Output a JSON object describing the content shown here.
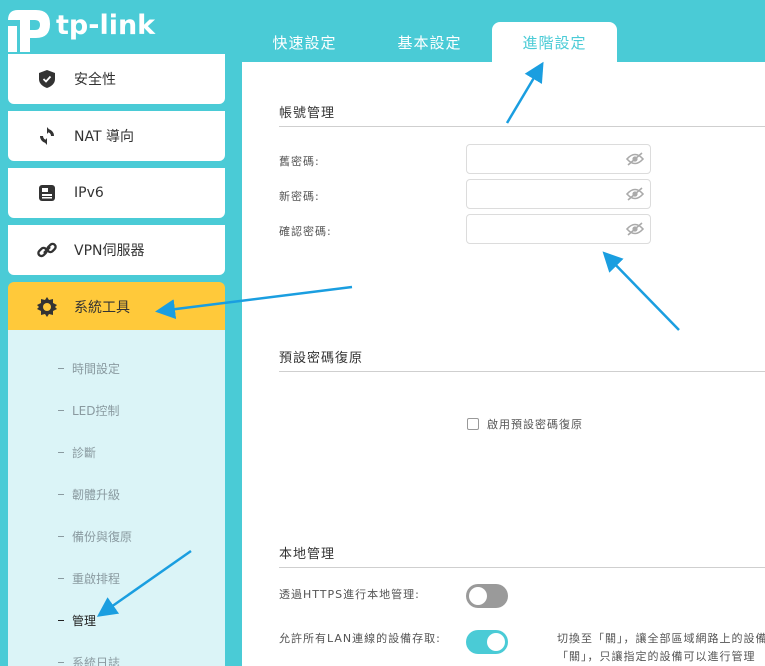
{
  "brand": {
    "name": "tp-link",
    "color": "#4acbd6",
    "active_color": "#ffc93a",
    "arrow_color": "#1a9ee0"
  },
  "tabs": [
    {
      "label": "快速設定",
      "active": false
    },
    {
      "label": "基本設定",
      "active": false
    },
    {
      "label": "進階設定",
      "active": true
    }
  ],
  "sidebar": {
    "items": [
      {
        "label": "安全性",
        "icon": "shield-icon"
      },
      {
        "label": "NAT 導向",
        "icon": "refresh-icon"
      },
      {
        "label": "IPv6",
        "icon": "document-icon"
      },
      {
        "label": "VPN伺服器",
        "icon": "link-icon"
      },
      {
        "label": "系統工具",
        "icon": "gear-icon",
        "active": true
      }
    ],
    "submenu": [
      {
        "label": "時間設定"
      },
      {
        "label": "LED控制"
      },
      {
        "label": "診斷"
      },
      {
        "label": "韌體升級"
      },
      {
        "label": "備份與復原"
      },
      {
        "label": "重啟排程"
      },
      {
        "label": "管理",
        "active": true
      },
      {
        "label": "系統日誌"
      }
    ]
  },
  "account": {
    "title": "帳號管理",
    "old_password_label": "舊密碼:",
    "new_password_label": "新密碼:",
    "confirm_password_label": "確認密碼:",
    "old_password_value": "",
    "new_password_value": "",
    "confirm_password_value": ""
  },
  "recovery": {
    "title": "預設密碼復原",
    "enable_label": "啟用預設密碼復原",
    "enabled": false
  },
  "local": {
    "title": "本地管理",
    "https_label": "透過HTTPS進行本地管理:",
    "https_enabled": false,
    "lan_label": "允許所有LAN連線的設備存取:",
    "lan_enabled": true,
    "note_line1": "切換至「關」，讓全部區域網路上的設備",
    "note_line2": "「關」，只讓指定的設備可以進行管理"
  }
}
